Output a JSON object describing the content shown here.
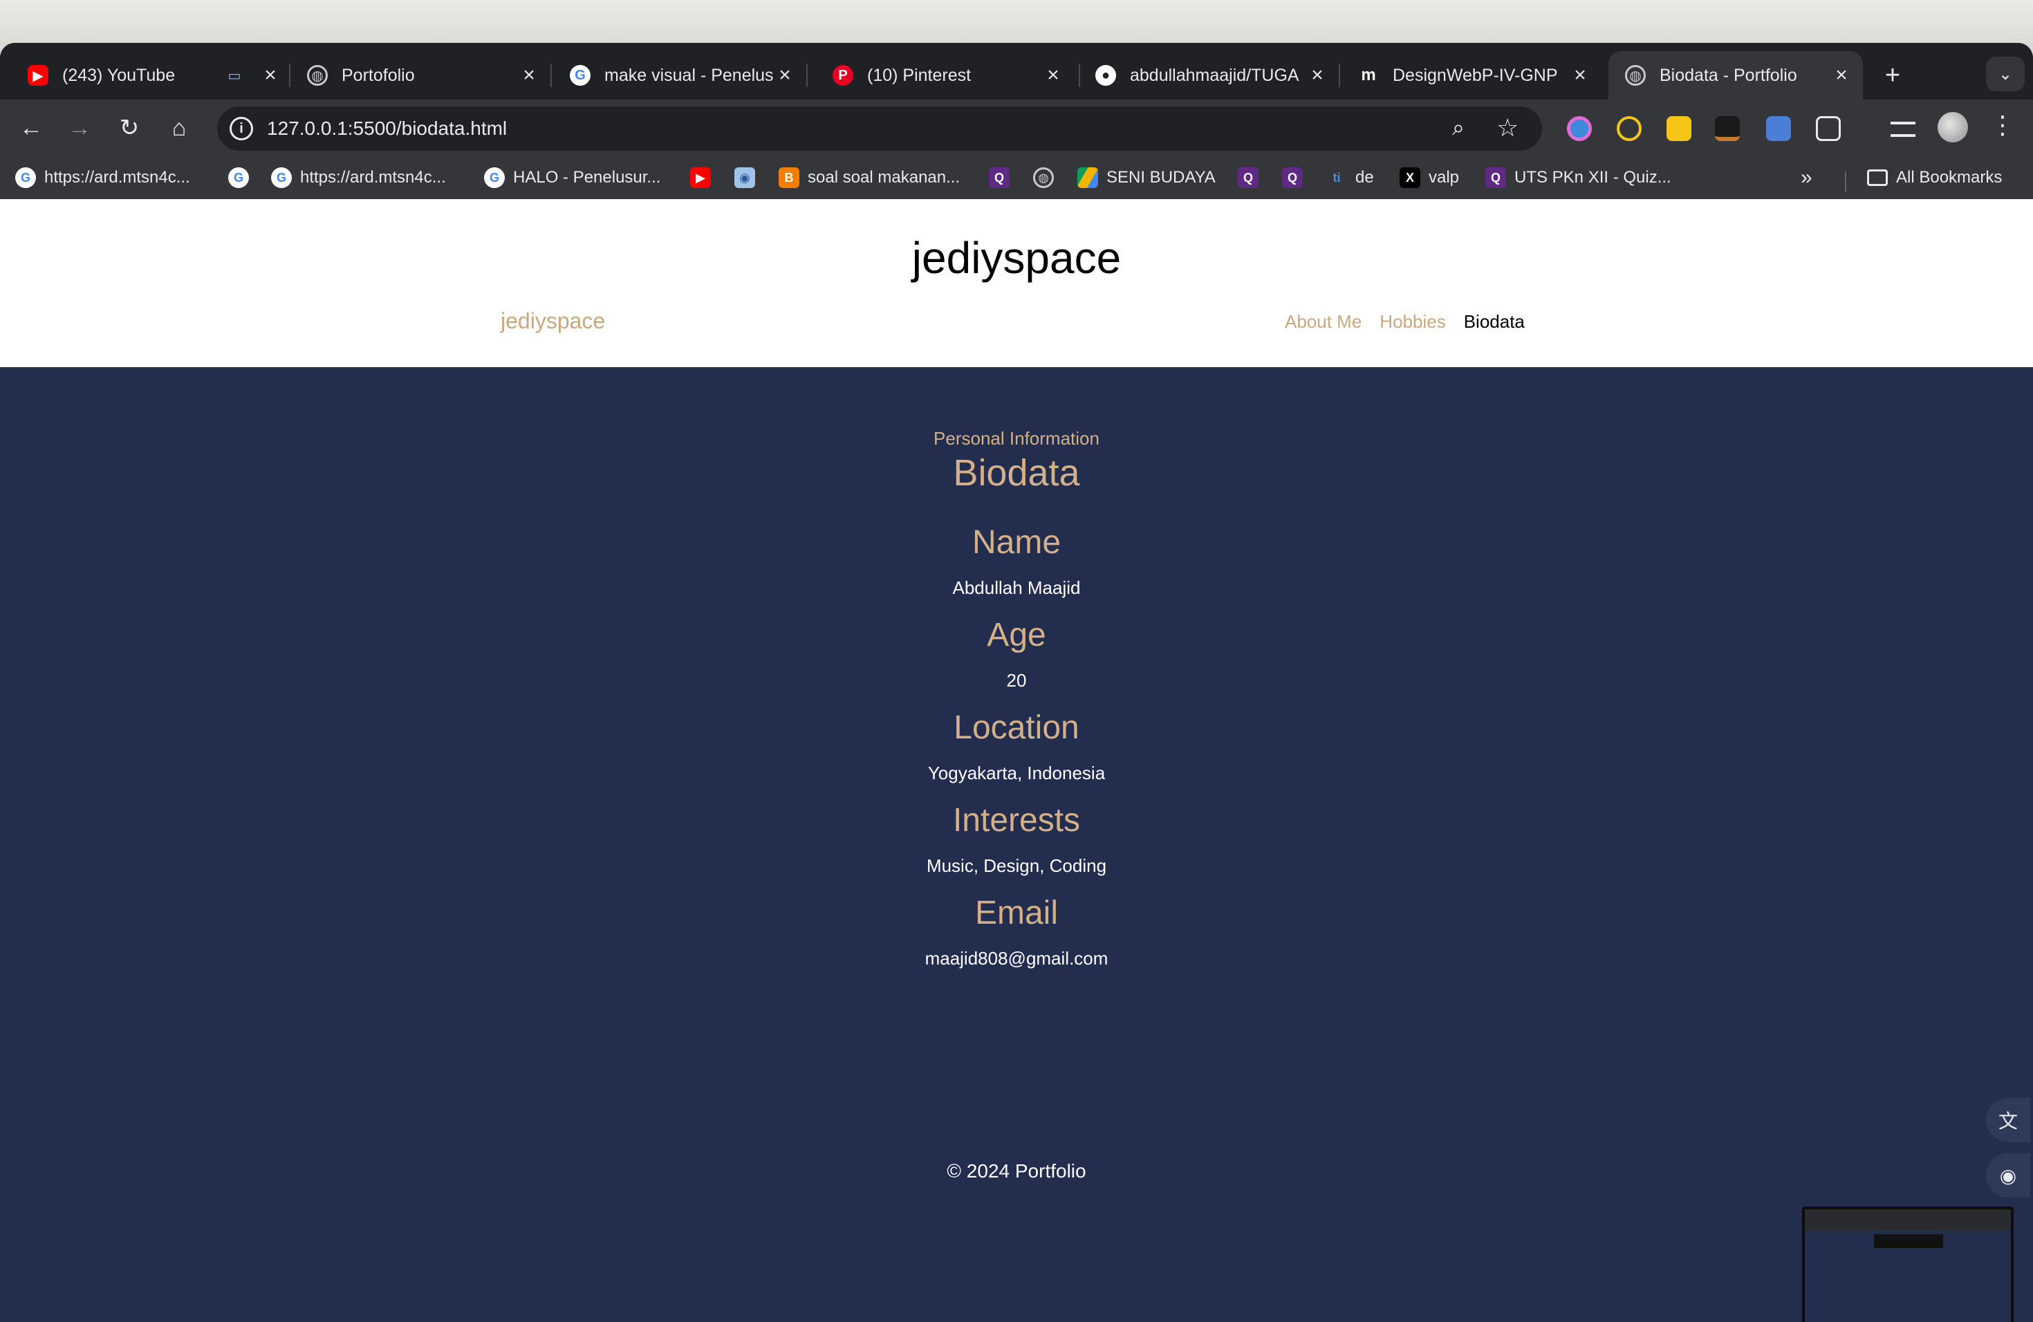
{
  "browser": {
    "tabs": [
      {
        "title": "(243) YouTube",
        "icon": "youtube-icon",
        "active": false
      },
      {
        "title": "",
        "icon": "screen-icon",
        "active": false
      },
      {
        "title": "Portofolio",
        "icon": "globe-icon",
        "active": false
      },
      {
        "title": "make visual - Penelus",
        "icon": "google-icon",
        "active": false
      },
      {
        "title": "(10) Pinterest",
        "icon": "pinterest-icon",
        "active": false
      },
      {
        "title": "abdullahmaajid/TUGA",
        "icon": "github-icon",
        "active": false
      },
      {
        "title": "DesignWebP-IV-GNP",
        "icon": "medium-icon",
        "active": false
      },
      {
        "title": "Biodata - Portfolio",
        "icon": "globe-icon",
        "active": true
      }
    ],
    "address_bar": {
      "url": "127.0.0.1:5500/biodata.html"
    },
    "bookmarks": [
      {
        "label": "https://ard.mtsn4c...",
        "icon": "google-icon"
      },
      {
        "label": "",
        "icon": "google-icon"
      },
      {
        "label": "https://ard.mtsn4c...",
        "icon": "google-icon"
      },
      {
        "label": "HALO - Penelusur...",
        "icon": "google-icon"
      },
      {
        "label": "",
        "icon": "youtube-icon"
      },
      {
        "label": "",
        "icon": "app-icon"
      },
      {
        "label": "soal soal makanan...",
        "icon": "blogger-icon"
      },
      {
        "label": "",
        "icon": "quizizz-icon"
      },
      {
        "label": "",
        "icon": "globe-icon"
      },
      {
        "label": "SENI BUDAYA",
        "icon": "drive-icon"
      },
      {
        "label": "",
        "icon": "quizizz-icon"
      },
      {
        "label": "",
        "icon": "quizizz-icon"
      },
      {
        "label": "de",
        "icon": "ti-icon"
      },
      {
        "label": "valp",
        "icon": "x-icon"
      },
      {
        "label": "UTS PKn XII - Quiz...",
        "icon": "quizizz-icon"
      }
    ],
    "all_bookmarks_label": "All Bookmarks"
  },
  "site": {
    "title": "jediyspace",
    "brand": "jediyspace",
    "nav": [
      {
        "label": "About Me",
        "current": false
      },
      {
        "label": "Hobbies",
        "current": false
      },
      {
        "label": "Biodata",
        "current": true
      }
    ]
  },
  "biodata": {
    "kicker": "Personal Information",
    "heading": "Biodata",
    "fields": [
      {
        "label": "Name",
        "value": "Abdullah Maajid"
      },
      {
        "label": "Age",
        "value": "20"
      },
      {
        "label": "Location",
        "value": "Yogyakarta, Indonesia"
      },
      {
        "label": "Interests",
        "value": "Music, Design, Coding"
      },
      {
        "label": "Email",
        "value": "maajid808@gmail.com"
      }
    ]
  },
  "footer": {
    "text": "© 2024 Portfolio"
  },
  "colors": {
    "page_bg": "#232d4d",
    "accent": "#d4b089",
    "brand": "#c8a880",
    "header_bg": "#ffffff"
  }
}
